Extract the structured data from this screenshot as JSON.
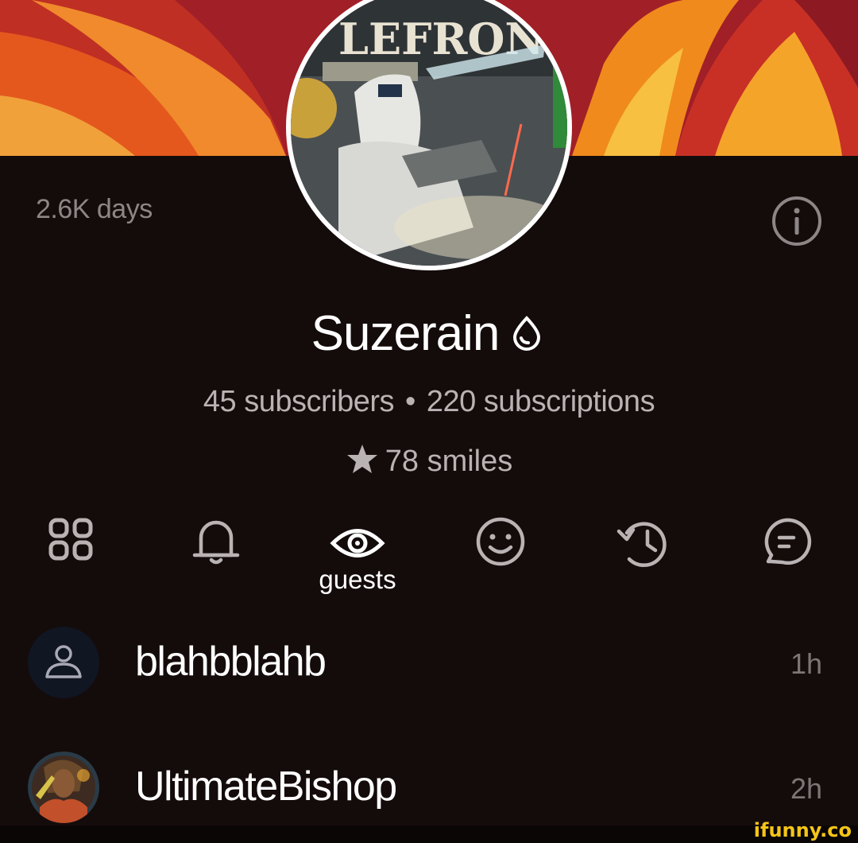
{
  "profile": {
    "age": "2.6K days",
    "username": "Suzerain",
    "subscribers": "45 subscribers",
    "separator": "•",
    "subscriptions": "220 subscriptions",
    "smiles": "78 smiles",
    "avatar_text": "LEFRONT"
  },
  "tabs": [
    {
      "icon": "grid-icon",
      "label": ""
    },
    {
      "icon": "bell-icon",
      "label": ""
    },
    {
      "icon": "eye-icon",
      "label": "guests",
      "active": true
    },
    {
      "icon": "smile-icon",
      "label": ""
    },
    {
      "icon": "history-icon",
      "label": ""
    },
    {
      "icon": "chat-icon",
      "label": ""
    }
  ],
  "guests": [
    {
      "name": "blahbblahb",
      "time": "1h",
      "avatar": "default-user-icon"
    },
    {
      "name": "UltimateBishop",
      "time": "2h",
      "avatar": "user-photo"
    }
  ],
  "watermark": "ifunny.co",
  "colors": {
    "background": "#140b0b",
    "text_primary": "#ffffff",
    "text_secondary": "#b9b3b3",
    "banner_orange": "#f07a1a",
    "banner_red": "#b3232a",
    "watermark": "#f5c518"
  }
}
